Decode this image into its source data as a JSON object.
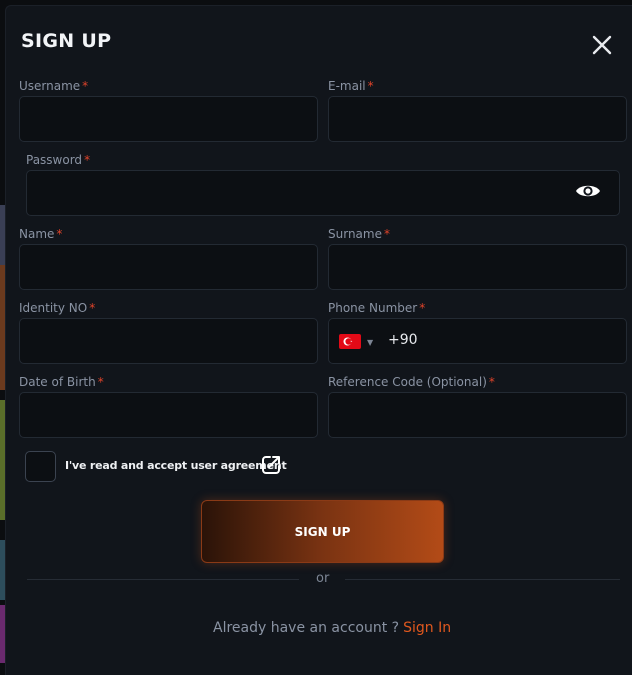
{
  "modal": {
    "title": "SIGN UP",
    "close_icon": "close-icon"
  },
  "fields": {
    "username": {
      "label": "Username",
      "required_mark": "*",
      "value": ""
    },
    "email": {
      "label": "E-mail",
      "required_mark": "*",
      "value": ""
    },
    "password": {
      "label": "Password",
      "required_mark": "*",
      "value": "",
      "toggle_icon": "eye-icon"
    },
    "name": {
      "label": "Name",
      "required_mark": "*",
      "value": ""
    },
    "surname": {
      "label": "Surname",
      "required_mark": "*",
      "value": ""
    },
    "identity": {
      "label": "Identity NO",
      "required_mark": "*",
      "value": ""
    },
    "phone": {
      "label": "Phone Number",
      "required_mark": "*",
      "dial_code": "+90",
      "country_flag": "turkey-flag-icon",
      "value": ""
    },
    "dob": {
      "label": "Date of Birth",
      "required_mark": "*",
      "value": ""
    },
    "reference": {
      "label": "Reference Code (Optional)",
      "required_mark": "*",
      "value": ""
    }
  },
  "agreement": {
    "label": "I've read and accept user agreement",
    "checked": false,
    "link_icon": "external-link-icon"
  },
  "actions": {
    "submit_label": "SIGN UP",
    "divider_text": "or",
    "signin_prompt": "Already have an account ?",
    "signin_link": "Sign In"
  },
  "colors": {
    "accent": "#e0581e",
    "required": "#e0442a",
    "background": "#11151b"
  }
}
